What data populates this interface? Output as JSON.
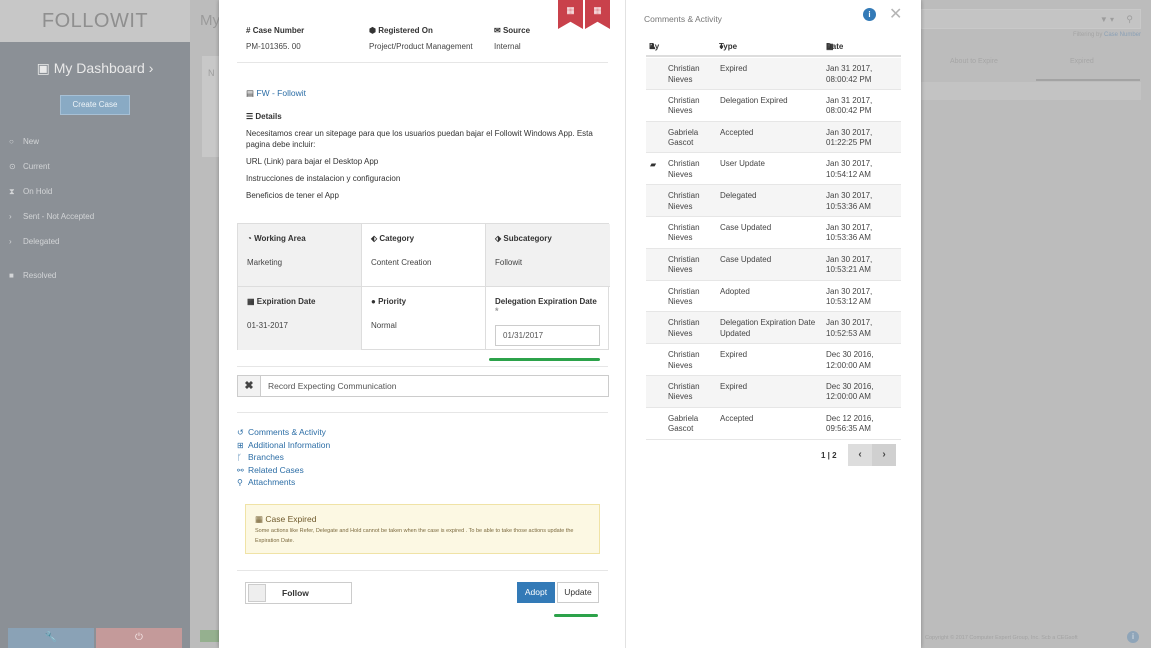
{
  "app": {
    "logo": "FOLLOWIT",
    "dashboard_label": "My Dashboard",
    "create_case": "Create Case",
    "nav": [
      {
        "icon": "○",
        "label": "New"
      },
      {
        "icon": "⊙",
        "label": "Current"
      },
      {
        "icon": "⧗",
        "label": "On Hold"
      },
      {
        "icon": "›",
        "label": "Sent - Not Accepted"
      },
      {
        "icon": "›",
        "label": "Delegated"
      },
      {
        "icon": "■",
        "label": "Resolved"
      }
    ],
    "page_title": "My",
    "panel_text": "N",
    "filtering_prefix": "Filtering by",
    "filtering_field": "Case Number",
    "tab_about_to_expire": "About to Expire",
    "tab_expired": "Expired",
    "copyright": "Copyright © 2017 Computer Expert Group, Inc. Scb a CEGsoft"
  },
  "case": {
    "number_label": "Case Number",
    "number": "PM-101365. 00",
    "registered_label": "Registered On",
    "registered": "Project/Product Management",
    "source_label": "Source",
    "source": "Internal",
    "fw_link": "FW - Followit",
    "details_label": "Details",
    "details": [
      "Necesitamos crear un sitepage para que los usuarios puedan bajar el Followit Windows App. Esta pagina debe incluir:",
      "URL (Link) para bajar el Desktop App",
      "Instrucciones de instalacion y configuracion",
      "Beneficios de tener el App"
    ],
    "working_area_label": "Working Area",
    "working_area": "Marketing",
    "category_label": "Category",
    "category": "Content Creation",
    "subcategory_label": "Subcategory",
    "subcategory": "Followit",
    "expiration_label": "Expiration Date",
    "expiration": "01-31-2017",
    "priority_label": "Priority",
    "priority": "Normal",
    "delegation_label": "Delegation Expiration Date",
    "delegation_required": "*",
    "delegation_value": "01/31/2017",
    "record_text": "Record Expecting Communication",
    "links": [
      {
        "icon": "↺",
        "label": "Comments & Activity"
      },
      {
        "icon": "⊞",
        "label": "Additional Information"
      },
      {
        "icon": "ᚴ",
        "label": "Branches"
      },
      {
        "icon": "⚯",
        "label": "Related Cases"
      },
      {
        "icon": "⚲",
        "label": "Attachments"
      }
    ],
    "warn_title": "Case Expired",
    "warn_body": "Some actions like Refer, Delegate and Hold cannot be taken when the case is expired . To be able to take those actions update the Expiration Date.",
    "follow_label": "Follow",
    "adopt_label": "Adopt",
    "update_label": "Update"
  },
  "activity": {
    "title": "Comments & Activity",
    "col_by": "By",
    "col_type": "Type",
    "col_date": "Date",
    "rows": [
      {
        "by": "Christian Nieves",
        "type": "Expired",
        "date": "Jan 31 2017, 08:00:42 PM",
        "icon": ""
      },
      {
        "by": "Christian Nieves",
        "type": "Delegation Expired",
        "date": "Jan 31 2017, 08:00:42 PM",
        "icon": ""
      },
      {
        "by": "Gabriela Gascot",
        "type": "Accepted",
        "date": "Jan 30 2017, 01:22:25 PM",
        "icon": ""
      },
      {
        "by": "Christian Nieves",
        "type": "User Update",
        "date": "Jan 30 2017, 10:54:12 AM",
        "icon": "comment"
      },
      {
        "by": "Christian Nieves",
        "type": "Delegated",
        "date": "Jan 30 2017, 10:53:36 AM",
        "icon": ""
      },
      {
        "by": "Christian Nieves",
        "type": "Case Updated",
        "date": "Jan 30 2017, 10:53:36 AM",
        "icon": ""
      },
      {
        "by": "Christian Nieves",
        "type": "Case Updated",
        "date": "Jan 30 2017, 10:53:21 AM",
        "icon": ""
      },
      {
        "by": "Christian Nieves",
        "type": "Adopted",
        "date": "Jan 30 2017, 10:53:12 AM",
        "icon": ""
      },
      {
        "by": "Christian Nieves",
        "type": "Delegation Expiration Date Updated",
        "date": "Jan 30 2017, 10:52:53 AM",
        "icon": ""
      },
      {
        "by": "Christian Nieves",
        "type": "Expired",
        "date": "Dec 30 2016, 12:00:00 AM",
        "icon": ""
      },
      {
        "by": "Christian Nieves",
        "type": "Expired",
        "date": "Dec 30 2016, 12:00:00 AM",
        "icon": ""
      },
      {
        "by": "Gabriela Gascot",
        "type": "Accepted",
        "date": "Dec 12 2016, 09:56:35 AM",
        "icon": ""
      }
    ],
    "pager": "1 | 2"
  },
  "colors": {
    "accent": "#337ab7",
    "ribbon": "#c9414b",
    "underline": "#2ca24a",
    "warning_bg": "#fcf8e3"
  }
}
